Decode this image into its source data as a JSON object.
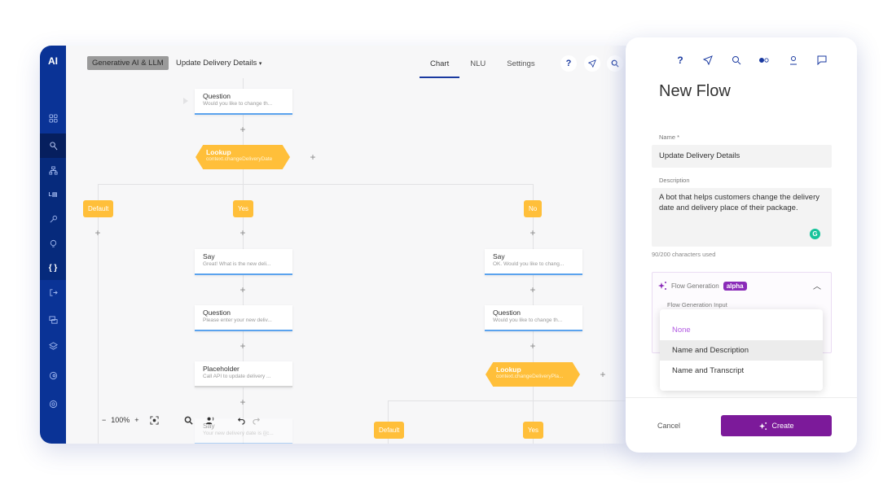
{
  "app": {
    "logo": "AI",
    "breadcrumb": {
      "category": "Generative AI & LLM",
      "flow": "Update Delivery Details",
      "dropdown_icon": "caret-down-icon"
    },
    "tabs": [
      {
        "label": "Chart",
        "active": true
      },
      {
        "label": "NLU",
        "active": false
      },
      {
        "label": "Settings",
        "active": false
      }
    ],
    "header_icons": [
      "help-icon",
      "compass-icon",
      "search-icon"
    ],
    "sidebar_icons": [
      "dashboard-icon",
      "flows-icon",
      "hierarchy-icon",
      "llm-icon",
      "tools-icon",
      "lightbulb-icon",
      "code-icon",
      "exit-icon",
      "chat-icon",
      "layers-icon",
      "analytics-icon",
      "settings-icon"
    ],
    "flow_nodes": [
      {
        "type": "Question",
        "text": "Would you like to change th..."
      },
      {
        "type": "Lookup",
        "text": "context.changeDeliveryDate"
      },
      {
        "type": "Say",
        "text": "Great! What is the new deli..."
      },
      {
        "type": "Question",
        "text": "Please enter your new deliv..."
      },
      {
        "type": "Placeholder",
        "text": "Call API to update delivery ..."
      },
      {
        "type": "Say",
        "text": "Your new delivery date is {{c..."
      },
      {
        "type": "Say",
        "text": "OK. Would you like to chang..."
      },
      {
        "type": "Question",
        "text": "Would you like to change th..."
      },
      {
        "type": "Lookup",
        "text": "context.changeDeliveryPla..."
      }
    ],
    "branches": {
      "default": "Default",
      "yes": "Yes",
      "no": "No"
    },
    "zoom": {
      "minus": "−",
      "level": "100%",
      "plus": "+"
    }
  },
  "panel": {
    "icons": [
      "help-icon",
      "compass-icon",
      "search-icon",
      "toggle-icon",
      "user-icon",
      "chat-icon"
    ],
    "help_glyph": "?",
    "title": "New Flow",
    "name_label": "Name *",
    "name_value": "Update Delivery Details",
    "description_label": "Description",
    "description_value": "A bot that helps customers change the delivery date and delivery place of their package.",
    "char_count": "90/200 characters used",
    "flow_generation": {
      "label": "Flow Generation",
      "badge": "alpha",
      "input_label": "Flow Generation Input",
      "options": [
        "None",
        "Name and Description",
        "Name and Transcript"
      ],
      "hovered": "Name and Description"
    },
    "cancel_label": "Cancel",
    "create_label": "Create"
  },
  "colors": {
    "sidebar": "#0a3396",
    "accent_yellow": "#ffbf3a",
    "node_underline": "#5ba3ee",
    "create_button": "#7c1a9a",
    "alpha_badge": "#8a2bb8"
  }
}
